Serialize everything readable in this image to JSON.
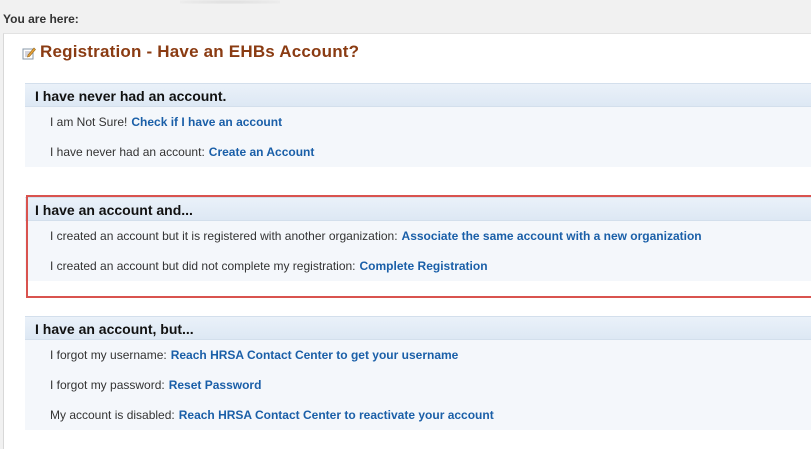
{
  "breadcrumb": {
    "label": "You are here:"
  },
  "page": {
    "title": "Registration - Have an EHBs Account?"
  },
  "sections": [
    {
      "header": "I have never had an account.",
      "rows": [
        {
          "text": "I am Not Sure!",
          "link": "Check if I have an account"
        },
        {
          "text": "I have never had an account:",
          "link": "Create an Account"
        }
      ]
    },
    {
      "header": "I have an account and...",
      "rows": [
        {
          "text": "I created an account but it is registered with another organization:",
          "link": "Associate the same account with a new organization"
        },
        {
          "text": "I created an account but did not complete my registration:",
          "link": "Complete Registration"
        }
      ]
    },
    {
      "header": "I have an account, but...",
      "rows": [
        {
          "text": "I forgot my username:",
          "link": "Reach HRSA Contact Center to get your username"
        },
        {
          "text": "I forgot my password:",
          "link": "Reset Password"
        },
        {
          "text": "My account is disabled:",
          "link": "Reach HRSA Contact Center to reactivate your account"
        }
      ]
    }
  ],
  "colors": {
    "title": "#8a3b12",
    "link": "#1a5fa8",
    "highlight": "#d9534f",
    "header_bg": "#e4edf7"
  },
  "icons": {
    "title_icon": "edit-icon"
  }
}
